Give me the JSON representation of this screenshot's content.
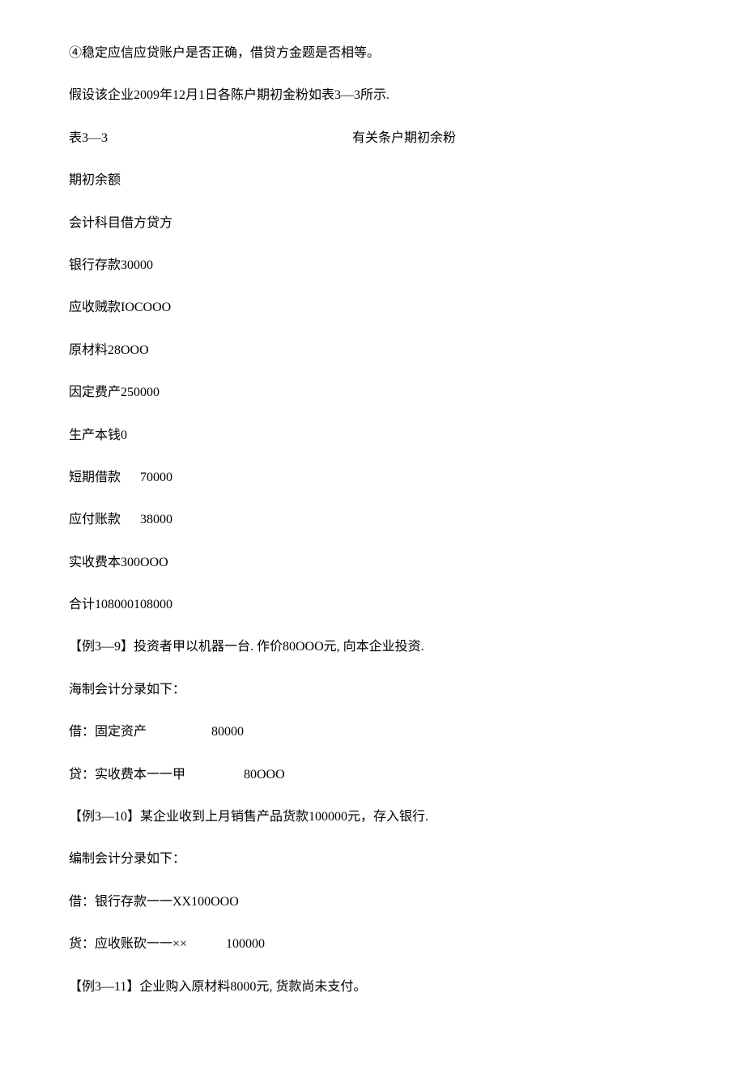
{
  "lines": {
    "l1": "④稳定应信应贷账户是否正确，借贷方金题是否相等。",
    "l2": "假设该企业2009年12月1日各陈户期初金粉如表3—3所示.",
    "l3_left": "表3—3",
    "l3_right": "有关条户期初余粉",
    "l4": "期初余额",
    "l5": "会计科目借方贷方",
    "l6": "银行存款30000",
    "l7": "应收贼款IOCOOO",
    "l8": "原材料28OOO",
    "l9": "因定费产250000",
    "l10": "生产本钱0",
    "l11": "短期借款      70000",
    "l12": "应付账款      38000",
    "l13": "实收费本300OOO",
    "l14": "合计108000108000",
    "l15": "【例3—9】投资者甲以机器一台. 作价80OOO元, 向本企业投资.",
    "l16": "海制会计分录如下：",
    "l17": "借：固定资产                    80000",
    "l18": "贷：实收费本一一甲                  80OOO",
    "l19": "【例3—10】某企业收到上月销售产品货款100000元，存入银行.",
    "l20": "编制会计分录如下：",
    "l21": "借：银行存款一一XX100OOO",
    "l22": "货：应收账砍一一××            100000",
    "l23": "【例3—11】企业购入原材料8000元, 货款尚未支付。"
  }
}
